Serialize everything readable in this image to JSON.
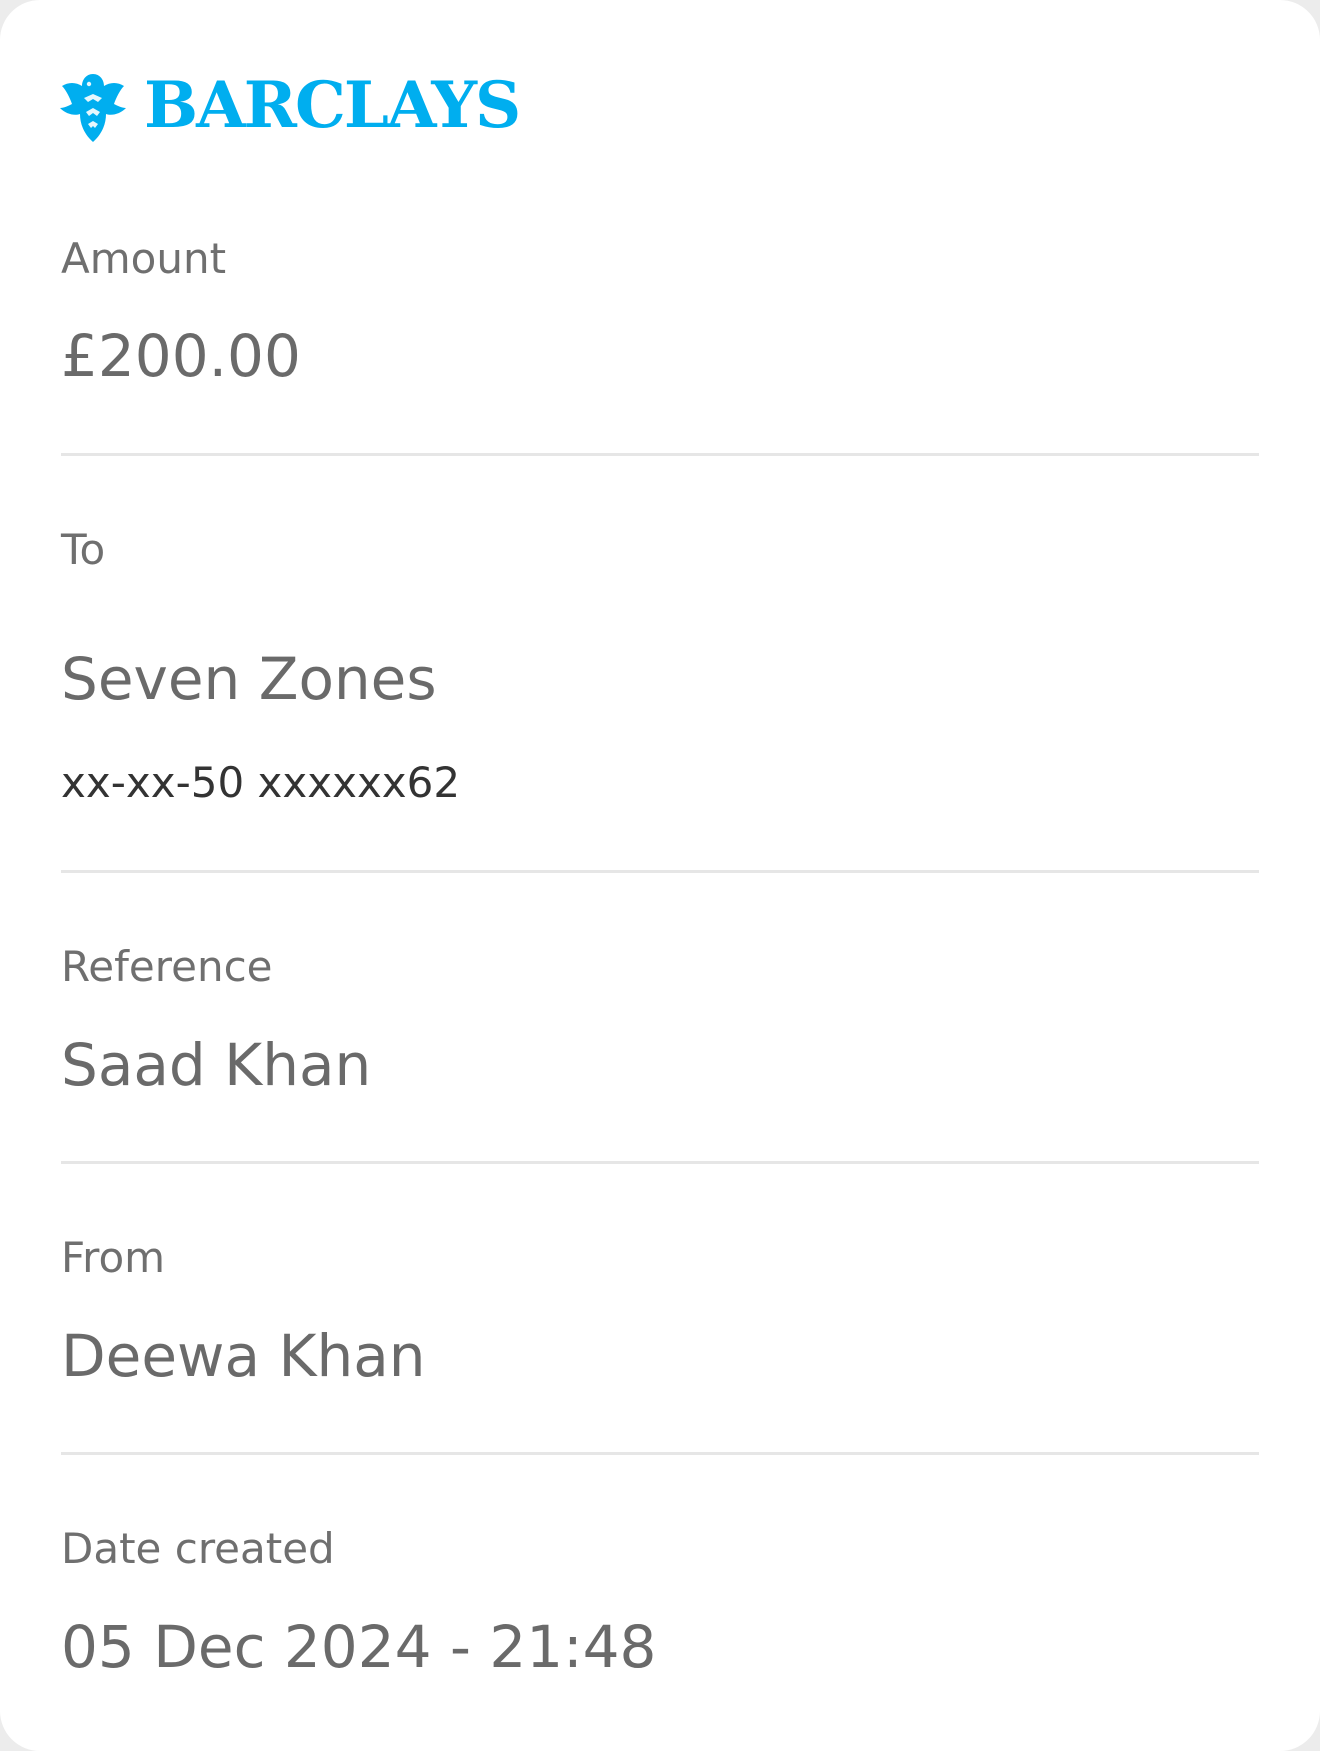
{
  "brand": {
    "name": "BARCLAYS",
    "color": "#00aeef"
  },
  "amount": {
    "label": "Amount",
    "value": "£200.00"
  },
  "to": {
    "label": "To",
    "name": "Seven Zones",
    "account": "xx-xx-50 xxxxxx62"
  },
  "reference": {
    "label": "Reference",
    "value": "Saad Khan"
  },
  "from": {
    "label": "From",
    "value": "Deewa Khan"
  },
  "date_created": {
    "label": "Date created",
    "value": "05 Dec 2024 - 21:48"
  },
  "colors": {
    "label": "#6f6f6f",
    "value": "#6a6a6a",
    "divider": "#e6e6e6"
  }
}
